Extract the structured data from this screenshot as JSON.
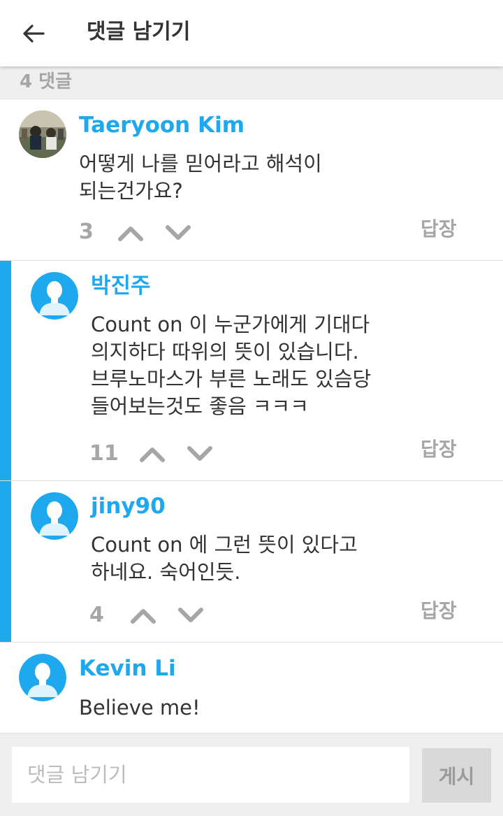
{
  "header": {
    "title": "댓글 남기기"
  },
  "comment_count_label": "4 댓글",
  "comments": [
    {
      "author": "Taeryoon Kim",
      "lines": [
        "어떻게 나를 믿어라고 해석이",
        "되는건가요?"
      ],
      "votes": "3",
      "reply_label": "답장",
      "avatar": "photo-avatar"
    },
    {
      "author": "박진주",
      "lines": [
        "Count on 이 누군가에게 기대다",
        "의지하다 따위의 뜻이 있습니다.",
        "브루노마스가 부른 노래도 있슴당",
        "들어보는것도 좋음 ㅋㅋㅋ"
      ],
      "votes": "11",
      "reply_label": "답장",
      "avatar": "default-user-avatar"
    },
    {
      "author": "jiny90",
      "lines": [
        "Count on 에 그런 뜻이 있다고",
        "하네요. 숙어인듯."
      ],
      "votes": "4",
      "reply_label": "답장",
      "avatar": "default-user-avatar"
    },
    {
      "author": "Kevin Li",
      "lines": [
        "Believe me!"
      ],
      "avatar": "default-user-avatar"
    }
  ],
  "footer": {
    "input_placeholder": "댓글 남기기",
    "input_value": "",
    "post_label": "게시"
  },
  "colors": {
    "accent": "#1ea8ee",
    "muted_text": "#a6a6a6",
    "background_gray": "#efefef",
    "body_text": "#333333"
  }
}
